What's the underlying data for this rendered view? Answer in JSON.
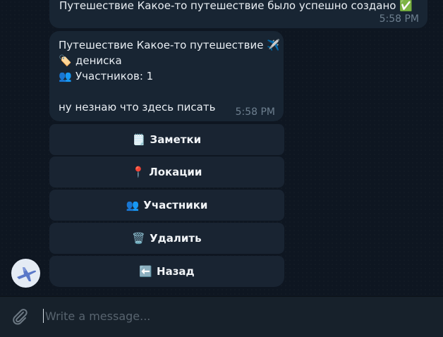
{
  "messages": {
    "created": {
      "text": "Путешествие Какое-то путешествие было успешно создано",
      "emoji": "✅",
      "time": "5:58 PM"
    },
    "details": {
      "title": "Путешествие Какое-то путешествие",
      "title_emoji": "✈️",
      "tag_emoji": "🏷️",
      "tag": "дениска",
      "participants_emoji": "👥",
      "participants": "Участников: 1",
      "description": "ну незнаю что здесь писать",
      "time": "5:58 PM"
    }
  },
  "keyboard": [
    {
      "emoji": "🗒️",
      "label": "Заметки"
    },
    {
      "emoji": "📍",
      "label": "Локации"
    },
    {
      "emoji": "👥",
      "label": "Участники"
    },
    {
      "emoji": "🗑️",
      "label": "Удалить"
    },
    {
      "emoji": "⬅️",
      "label": "Назад"
    }
  ],
  "composer": {
    "placeholder": "Write a message..."
  },
  "icons": {
    "attach": "paperclip-icon",
    "avatar": "airplane-icon"
  },
  "colors": {
    "background": "#0e1621",
    "bubble": "#182533",
    "input_bar": "#17212b",
    "time": "#6d7f8f"
  }
}
